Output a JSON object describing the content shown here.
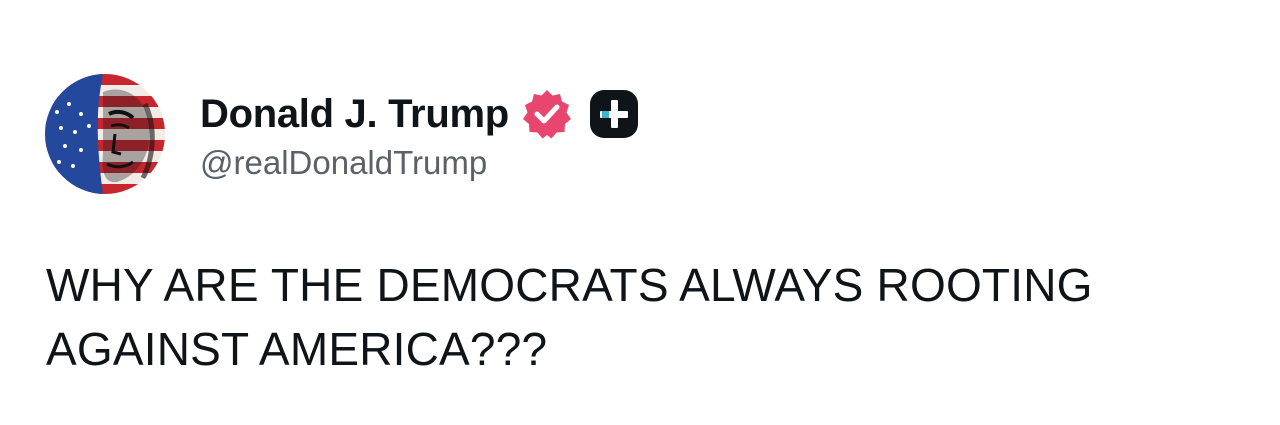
{
  "author": {
    "display_name": "Donald J. Trump",
    "handle": "@realDonaldTrump",
    "avatar_icon": "flag-portrait-avatar",
    "verified_icon": "verified-check-badge-icon",
    "verified_color": "#e8456f",
    "subscription_icon": "plus-badge-icon",
    "subscription_color": "#0f1419"
  },
  "post": {
    "text": "WHY ARE THE DEMOCRATS ALWAYS ROOTING AGAINST AMERICA???"
  }
}
